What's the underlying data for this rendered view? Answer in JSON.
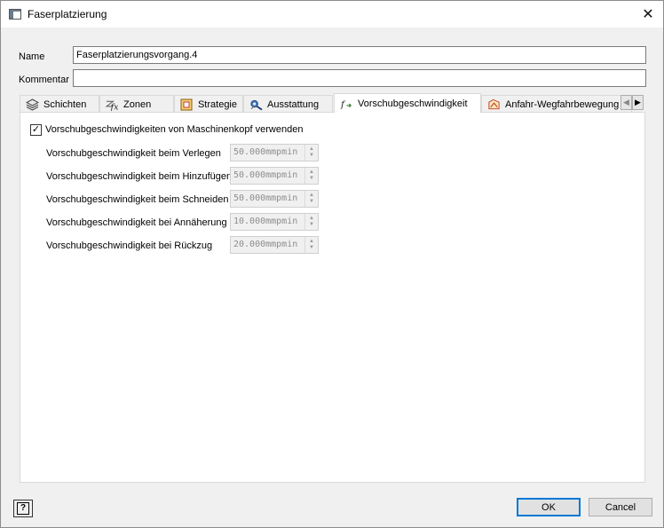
{
  "window": {
    "title": "Faserplatzierung",
    "close_symbol": "✕"
  },
  "fields": {
    "name_label": "Name",
    "name_value": "Faserplatzierungsvorgang.4",
    "comment_label": "Kommentar",
    "comment_value": ""
  },
  "tabs": [
    {
      "label": "Schichten",
      "icon": "layers-icon",
      "active": false
    },
    {
      "label": "Zonen",
      "icon": "zones-fx-icon",
      "active": false
    },
    {
      "label": "Strategie",
      "icon": "strategy-icon",
      "active": false
    },
    {
      "label": "Ausstattung",
      "icon": "equipment-icon",
      "active": false
    },
    {
      "label": "Vorschubgeschwindigkeit",
      "icon": "feedrate-fx-icon",
      "active": true
    },
    {
      "label": "Anfahr-Wegfahrbewegung",
      "icon": "approach-retract-icon",
      "active": false
    }
  ],
  "feedrates": {
    "use_machine_head_label": "Vorschubgeschwindigkeiten von Maschinenkopf verwenden",
    "use_machine_head_checked": true,
    "rows": [
      {
        "label": "Vorschubgeschwindigkeit beim Verlegen",
        "value": "50.000mmpmin"
      },
      {
        "label": "Vorschubgeschwindigkeit beim Hinzufügen",
        "value": "50.000mmpmin"
      },
      {
        "label": "Vorschubgeschwindigkeit beim Schneiden",
        "value": "50.000mmpmin"
      },
      {
        "label": "Vorschubgeschwindigkeit bei Annäherung",
        "value": "10.000mmpmin"
      },
      {
        "label": "Vorschubgeschwindigkeit bei Rückzug",
        "value": "20.000mmpmin"
      }
    ]
  },
  "buttons": {
    "ok": "OK",
    "cancel": "Cancel",
    "help": "?"
  },
  "colors": {
    "accent": "#0078d7",
    "disabled_text": "#8d8d8d"
  }
}
